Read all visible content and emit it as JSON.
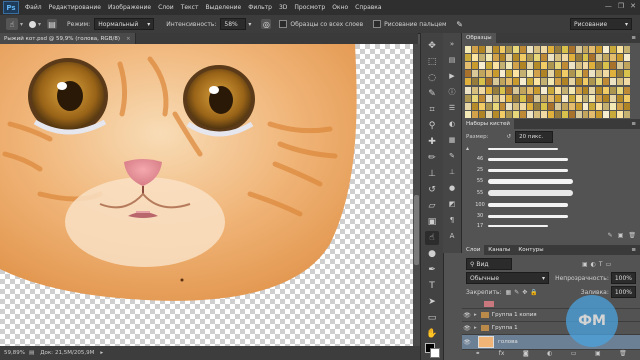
{
  "app": {
    "logo": "Ps"
  },
  "menu": [
    "Файл",
    "Редактирование",
    "Изображение",
    "Слои",
    "Текст",
    "Выделение",
    "Фильтр",
    "3D",
    "Просмотр",
    "Окно",
    "Справка"
  ],
  "window_controls": [
    "—",
    "❐",
    "✕"
  ],
  "options": {
    "mode_label": "Режим:",
    "mode_value": "Нормальный",
    "intensity_label": "Интенсивность:",
    "intensity_value": "58%",
    "sample_all": "Образцы со всех слоев",
    "finger_paint": "Рисование пальцем",
    "workspace": "Рисование"
  },
  "document": {
    "tab": "Рыжий кот.psd @ 59,9% (голова, RGB/8)",
    "close": "×"
  },
  "status": {
    "zoom": "59,89%",
    "doc_label": "Док:",
    "doc_value": "21,5M/205,9M"
  },
  "swatches_panel": {
    "title": "Образцы"
  },
  "brushes_panel": {
    "title": "Наборы кистей",
    "size_label": "Размер:",
    "size_value": "20 пикс.",
    "brush_sizes": [
      "",
      "46",
      "25",
      "55",
      "55",
      "100",
      "30",
      "17"
    ]
  },
  "layers_panel": {
    "tabs": [
      "Слои",
      "Каналы",
      "Контуры"
    ],
    "filter": "Вид",
    "blend": "Обычные",
    "opacity_label": "Непрозрачность:",
    "opacity_value": "100%",
    "lock_label": "Закрепить:",
    "fill_label": "Заливка:",
    "fill_value": "100%",
    "layers": [
      {
        "name": "Группа 1 копия",
        "type": "group"
      },
      {
        "name": "Группа 1",
        "type": "group"
      },
      {
        "name": "голова",
        "type": "layer",
        "selected": true
      }
    ]
  },
  "watermark": "ФМ",
  "colors": {
    "accent": "#4aa3df",
    "fur": "#e8a45c"
  }
}
